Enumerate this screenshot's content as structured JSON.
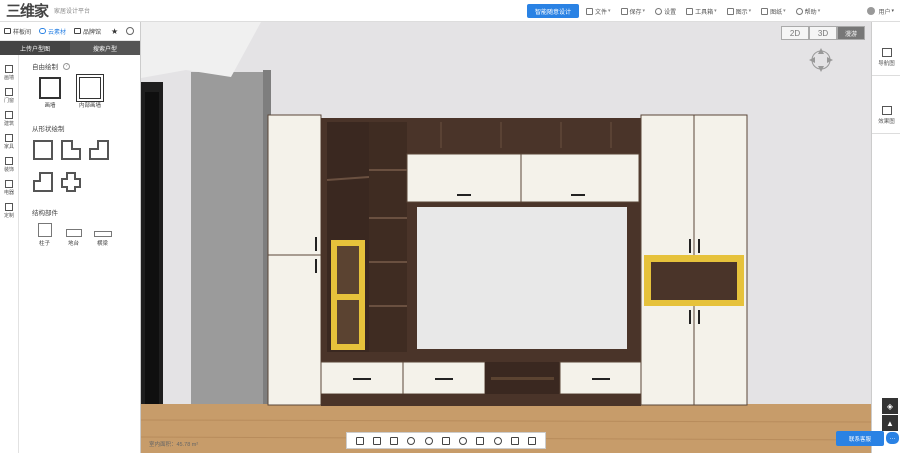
{
  "app": {
    "logo_text": "三维家",
    "logo_subtitle": "家居设计平台"
  },
  "topbar": {
    "primary_button": "智能随意设计",
    "menu": [
      {
        "label": "文件",
        "icon": "file-icon"
      },
      {
        "label": "保存",
        "icon": "save-icon"
      },
      {
        "label": "设置",
        "icon": "gear-icon"
      },
      {
        "label": "工具箱",
        "icon": "toolbox-icon"
      },
      {
        "label": "图示",
        "icon": "display-icon"
      },
      {
        "label": "图纸",
        "icon": "drawing-icon"
      },
      {
        "label": "帮助",
        "icon": "help-icon"
      }
    ],
    "user": "用户"
  },
  "leftpanel": {
    "tabs": [
      {
        "label": "样板间",
        "icon": "template-icon"
      },
      {
        "label": "云素材",
        "icon": "cloud-icon"
      },
      {
        "label": "品牌馆",
        "icon": "brand-icon"
      }
    ],
    "subtabs": [
      "上传户型图",
      "搜索户型"
    ],
    "rail": [
      {
        "label": "画墙",
        "icon": "draw-wall-icon"
      },
      {
        "label": "门窗",
        "icon": "door-window-icon"
      },
      {
        "label": "建筑",
        "icon": "building-icon"
      },
      {
        "label": "家具",
        "icon": "furniture-icon"
      },
      {
        "label": "装饰",
        "icon": "decoration-icon"
      },
      {
        "label": "电器",
        "icon": "appliance-icon"
      },
      {
        "label": "定制",
        "icon": "custom-icon"
      }
    ],
    "section_free_draw": "自由绘制",
    "tools": [
      {
        "label": "画墙"
      },
      {
        "label": "内部画墙"
      }
    ],
    "section_shapes": "从形状绘制",
    "section_structure": "结构部件",
    "structures": [
      {
        "label": "柱子"
      },
      {
        "label": "地台"
      },
      {
        "label": "横梁"
      }
    ]
  },
  "viewport": {
    "view_2d": "2D",
    "view_3d": "3D",
    "view_roam": "漫游",
    "area_readout": "室内面积：45.78 m²"
  },
  "rightpanel": {
    "buttons": [
      {
        "label": "导航图",
        "icon": "home-icon"
      },
      {
        "label": "效果图",
        "icon": "camera-icon"
      }
    ],
    "service_label": "联系客服"
  },
  "colors": {
    "accent": "#2a82e4",
    "wood_dark": "#4a3429",
    "panel_white": "#f4f2ea",
    "accent_yellow": "#e6c23b",
    "floor": "#c79c6a"
  }
}
